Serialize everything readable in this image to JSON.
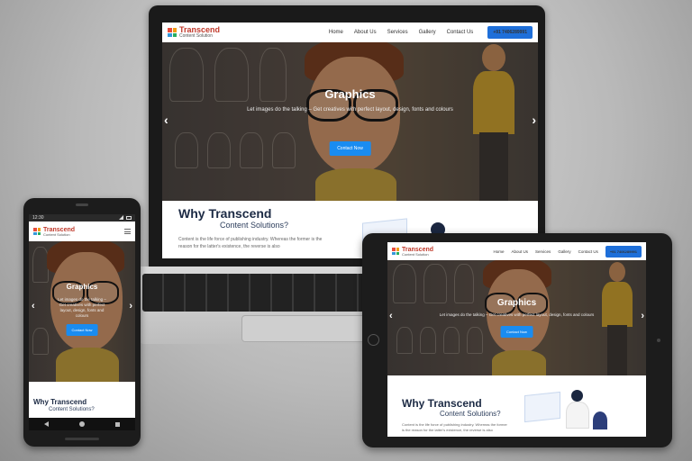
{
  "brand": {
    "name": "Transcend",
    "tagline": "Content Solution"
  },
  "nav": {
    "items": [
      "Home",
      "About Us",
      "Services",
      "Gallery",
      "Contact Us"
    ],
    "phone": "+91 7406289991"
  },
  "hero": {
    "title": "Graphics",
    "subtitle": "Let images do the talking – Get creatives with perfect layout, design, fonts and colours",
    "button": "Contact Now",
    "prev_icon": "‹",
    "next_icon": "›"
  },
  "why": {
    "title": "Why Transcend",
    "subtitle": "Content Solutions?",
    "body_laptop": "Content is the life force of publishing industry. Whereas the former is the reason for the latter's existence, the reverse is also",
    "body_tablet": "Content is the life force of publishing industry. Whereas the former is the reason for the latter's existence, the reverse is also"
  },
  "phone_status": {
    "time": "12:30"
  },
  "colors": {
    "brand_red": "#c0392b",
    "accent_blue": "#1e6fd9",
    "button_blue": "#1a8cf0",
    "heading_navy": "#1c2a44"
  }
}
